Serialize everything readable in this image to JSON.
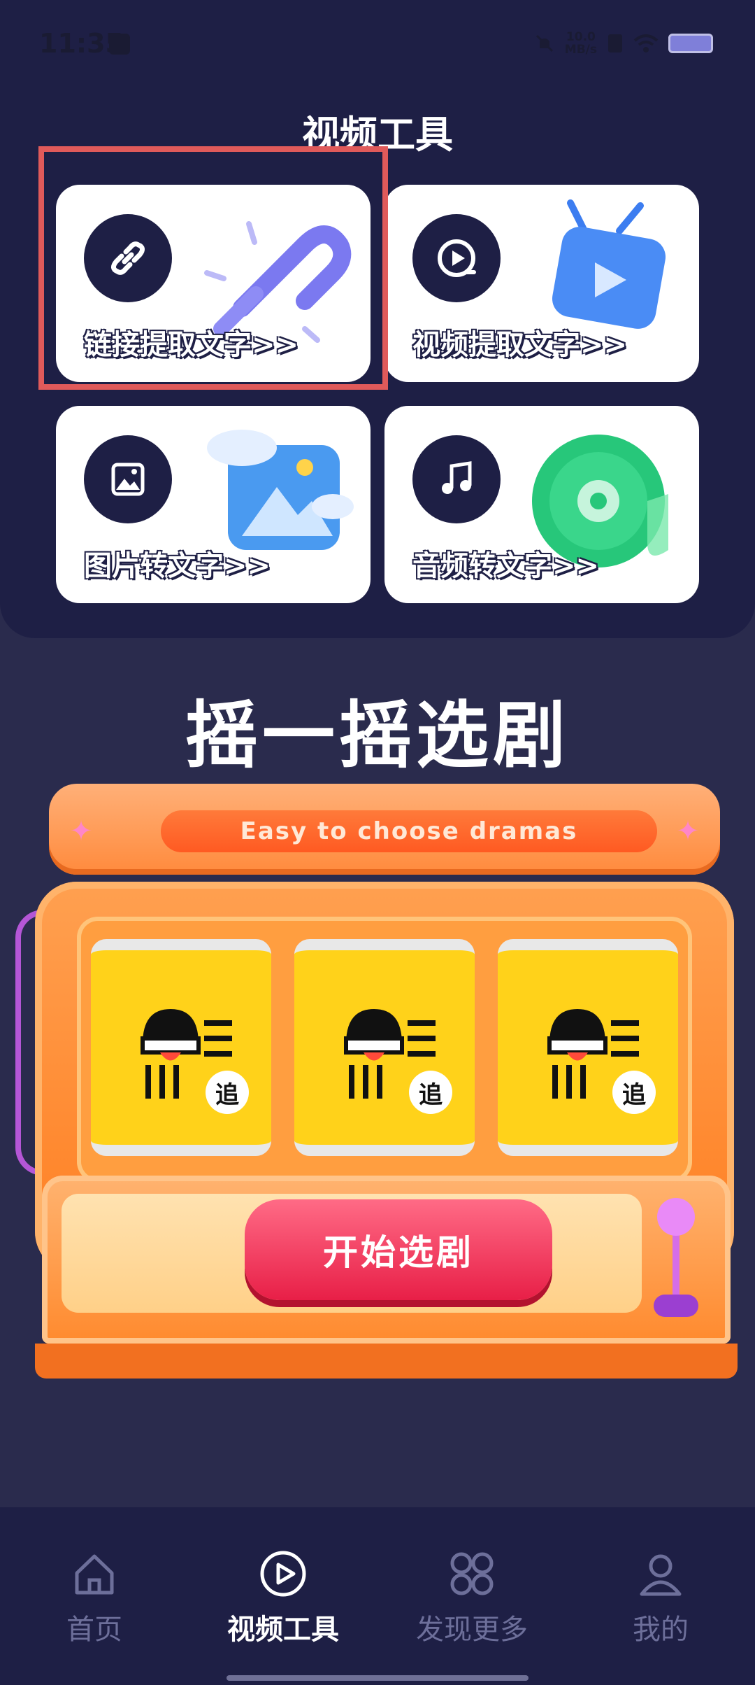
{
  "status_bar": {
    "time": "11:35",
    "speed_value": "10.0",
    "speed_unit": "MB/s"
  },
  "tools": {
    "title": "视频工具",
    "items": [
      {
        "label": "链接提取文字>>",
        "icon": "link-icon"
      },
      {
        "label": "视频提取文字>>",
        "icon": "play-circle-icon"
      },
      {
        "label": "图片转文字>>",
        "icon": "image-icon"
      },
      {
        "label": "音频转文字>>",
        "icon": "music-note-icon"
      }
    ]
  },
  "shake": {
    "title": "摇一摇选剧",
    "banner": "Easy to choose dramas",
    "reel_badge": "追",
    "start_button": "开始选剧"
  },
  "nav": {
    "items": [
      {
        "label": "首页",
        "icon": "home-icon"
      },
      {
        "label": "视频工具",
        "icon": "play-circle-icon",
        "active": true
      },
      {
        "label": "发现更多",
        "icon": "grid-icon"
      },
      {
        "label": "我的",
        "icon": "user-icon"
      }
    ]
  },
  "colors": {
    "panel": "#1e1f45",
    "background": "#2a2b4d",
    "highlight": "#e05a5a",
    "accent_orange": "#ff8a3c",
    "start_red": "#e81f47"
  }
}
